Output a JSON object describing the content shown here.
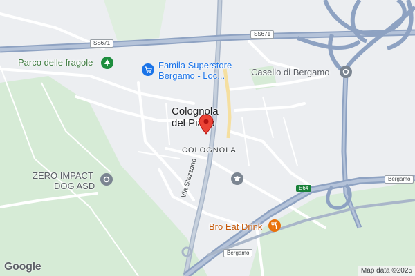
{
  "place": {
    "title_line1": "Colognola",
    "title_line2": "del Piano",
    "district": "COLOGNOLA"
  },
  "pois": {
    "park": "Parco delle fragole",
    "store_line1": "Famila Superstore",
    "store_line2": "Bergamo - Loc...",
    "toll": "Casello di Bergamo",
    "dog": "ZERO IMPACT",
    "dog_line2": "DOG ASD",
    "restaurant": "Bro Eat Drink"
  },
  "roads": {
    "ss671_left": "SS671",
    "ss671_right": "SS671",
    "e64": "E64",
    "bergamo_sign_right": "Bergamo",
    "bergamo_sign_bottom": "Bergamo",
    "via_stezzano": "Via Stezzano"
  },
  "footer": {
    "logo": "Google",
    "attribution": "Map data ©2025"
  },
  "colors": {
    "highway": "#8ea2c2",
    "green_area": "#d6ebd6",
    "marker": "#ea4335",
    "toll_icon": "#7b8591",
    "store_icon": "#1a73e8",
    "park_icon": "#1e8e3e",
    "restaurant_icon": "#e8710a"
  },
  "icons": {
    "park": "tree-icon",
    "store": "shopping-cart-icon",
    "toll": "circle-dot-icon",
    "dog": "circle-dot-icon",
    "school": "graduation-cap-icon",
    "restaurant": "fork-knife-icon",
    "marker": "map-pin-icon"
  }
}
